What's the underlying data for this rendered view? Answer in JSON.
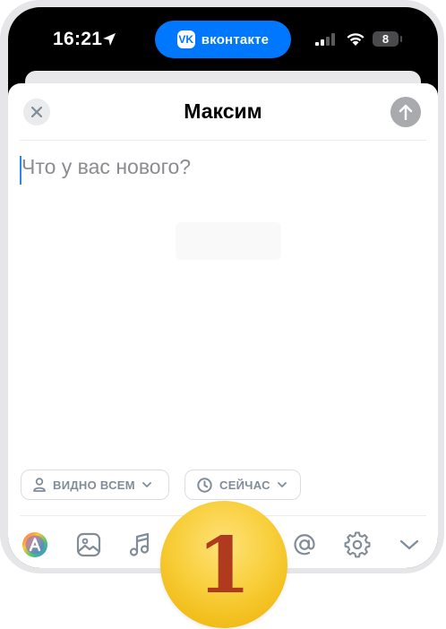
{
  "status_bar": {
    "time": "16:21",
    "app_pill_label": "вконтакте",
    "app_pill_logo": "VK",
    "battery_level": "8",
    "pill_color": "#0077ff"
  },
  "composer": {
    "title": "Максим",
    "placeholder": "Что у вас нового?",
    "visibility_chip": "ВИДНО ВСЕМ",
    "time_chip": "СЕЙЧАС"
  },
  "toolbar": {
    "icons": [
      "text-style-icon",
      "photo-icon",
      "music-icon",
      "mention-icon",
      "gear-icon",
      "chevron-down-icon"
    ]
  },
  "badge": {
    "number": "1"
  }
}
